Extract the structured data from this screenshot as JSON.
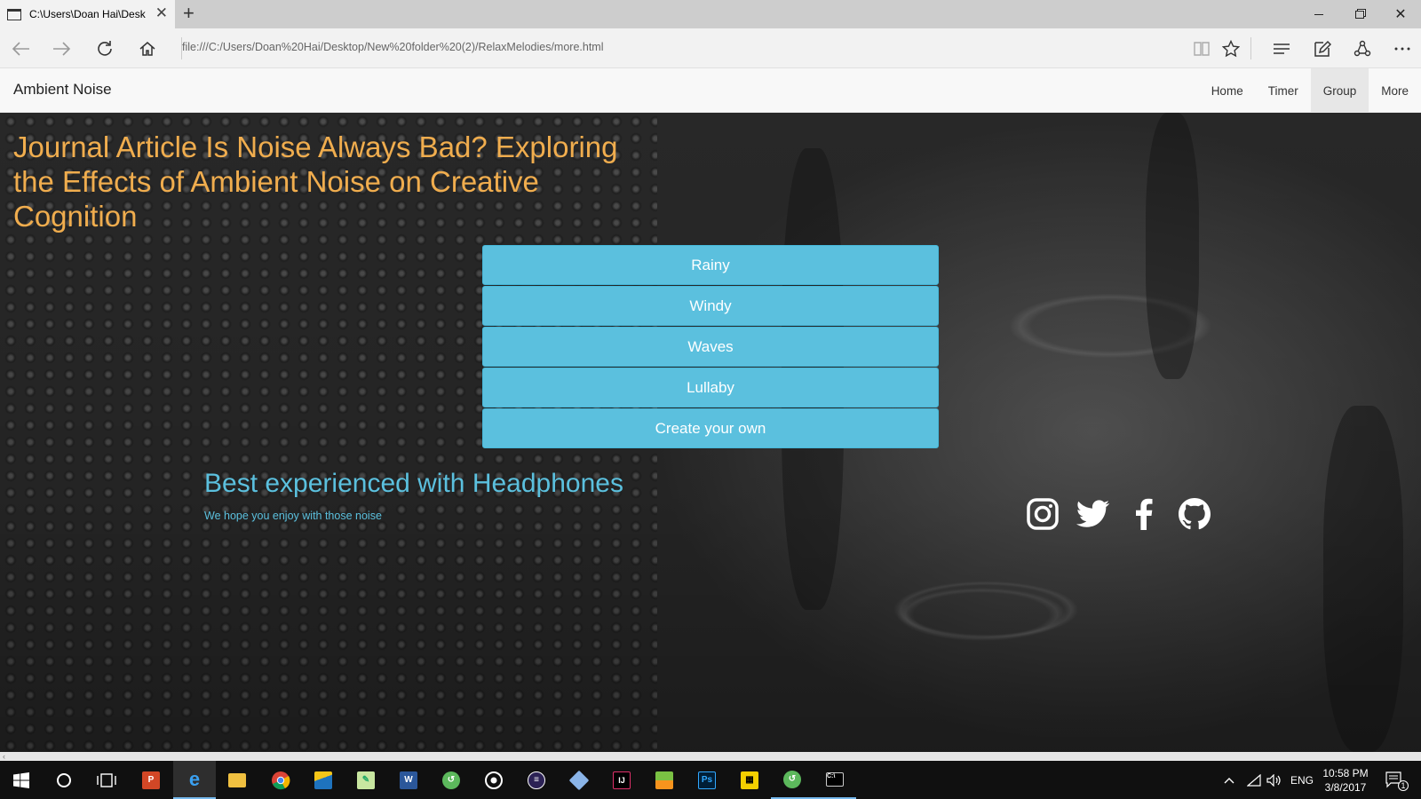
{
  "browser": {
    "tab_title": "C:\\Users\\Doan Hai\\Desk",
    "tab_close": "✕",
    "new_tab": "+",
    "url": "file:///C:/Users/Doan%20Hai/Desktop/New%20folder%20(2)/RelaxMelodies/more.html",
    "window_close": "✕"
  },
  "navbar": {
    "brand": "Ambient Noise",
    "links": [
      {
        "label": "Home"
      },
      {
        "label": "Timer"
      },
      {
        "label": "Group",
        "active": true
      },
      {
        "label": "More"
      }
    ]
  },
  "main": {
    "article_title": "Journal Article Is Noise Always Bad? Exploring the Effects of Ambient Noise on Creative Cognition",
    "sounds": [
      "Rainy",
      "Windy",
      "Waves",
      "Lullaby",
      "Create your own"
    ],
    "headline": "Best experienced with Headphones",
    "subline": "We hope you enjoy with those noise",
    "social": [
      "instagram-icon",
      "twitter-icon",
      "facebook-icon",
      "github-icon"
    ]
  },
  "taskbar": {
    "language": "ENG",
    "time": "10:58 PM",
    "date": "3/8/2017",
    "notification_count": "1"
  },
  "colors": {
    "accent_info": "#5bc0de",
    "article_title": "#f0ad4e"
  }
}
